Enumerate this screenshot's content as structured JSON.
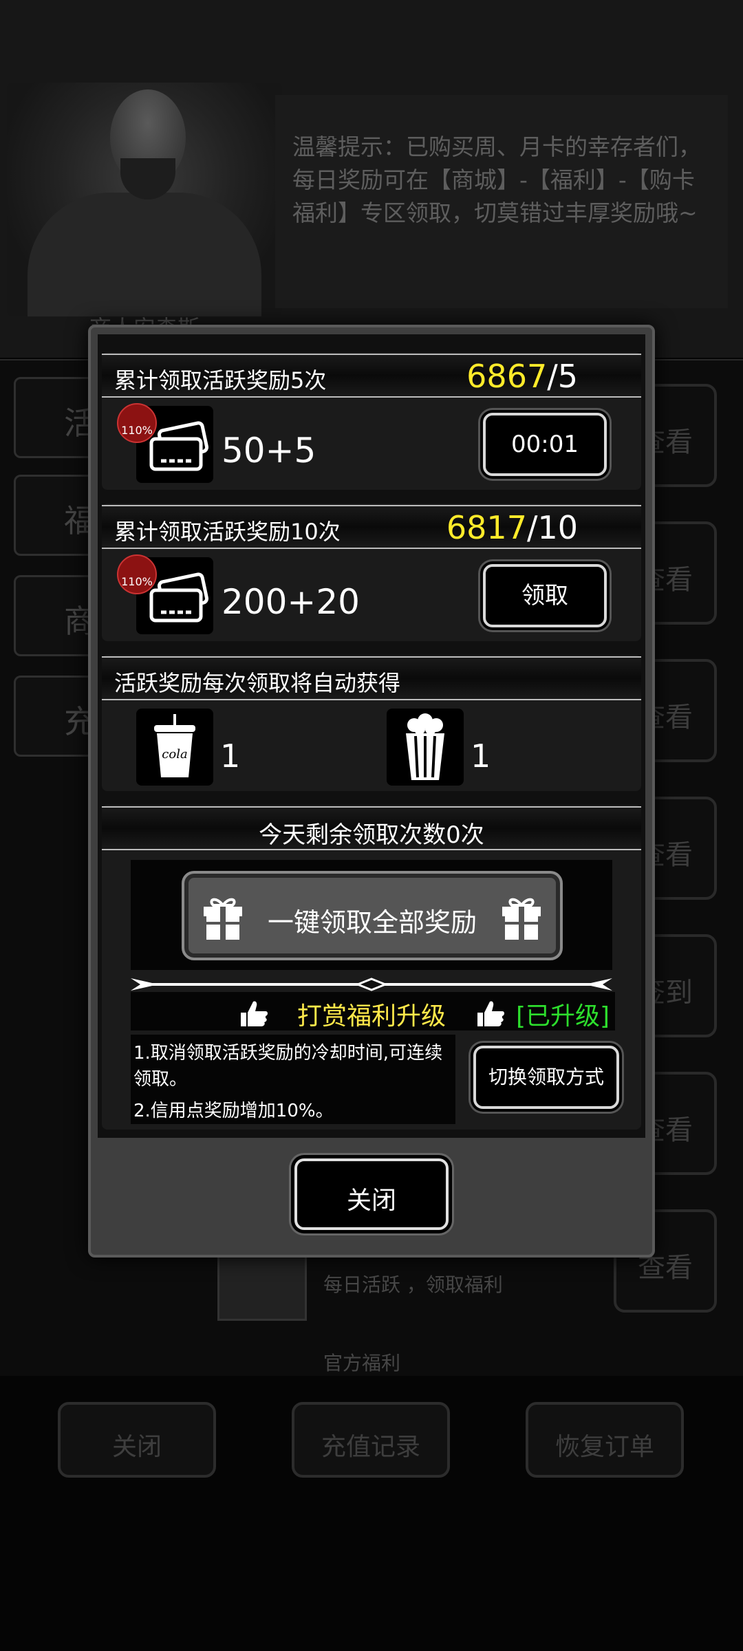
{
  "background": {
    "npc_name": "商人安森斯",
    "tip": "温馨提示：已购买周、月卡的幸存者们，每日奖励可在【商城】-【福利】-【购卡福利】专区领取，切莫错过丰厚奖励哦~",
    "side_tabs": [
      "活",
      "福",
      "商",
      "充"
    ],
    "right_buttons": [
      "查看",
      "查看",
      "查看",
      "查看",
      "签到",
      "查看",
      "查看"
    ],
    "rows": [
      "每日活跃 ，领取福利",
      "官方福利"
    ],
    "bottom_buttons": {
      "close": "关闭",
      "recharge_record": "充值记录",
      "restore_order": "恢复订单"
    }
  },
  "modal": {
    "tier1": {
      "title": "累计领取活跃奖励5次",
      "current": "6867",
      "target": "/5",
      "badge": "110%",
      "reward": "50+5",
      "button": "00:01"
    },
    "tier2": {
      "title": "累计领取活跃奖励10次",
      "current": "6817",
      "target": "/10",
      "badge": "110%",
      "reward": "200+20",
      "button": "领取"
    },
    "auto": {
      "title": "活跃奖励每次领取将自动获得",
      "items": [
        {
          "icon": "cola-icon",
          "icon_text": "cola",
          "count": "1"
        },
        {
          "icon": "popcorn-icon",
          "count": "1"
        }
      ]
    },
    "remaining": "今天剩余领取次数0次",
    "claim_all": "一键领取全部奖励",
    "vip": {
      "label": "打赏福利升级",
      "status": "[已升级]"
    },
    "desc_1": "1.取消领取活跃奖励的冷却时间,可连续领取。",
    "desc_2": "2.信用点奖励增加10%。",
    "switch_button": "切换领取方式",
    "close_button": "关闭"
  },
  "colors": {
    "accent_yellow": "#ffeb2a",
    "status_green": "#2dde2d"
  }
}
